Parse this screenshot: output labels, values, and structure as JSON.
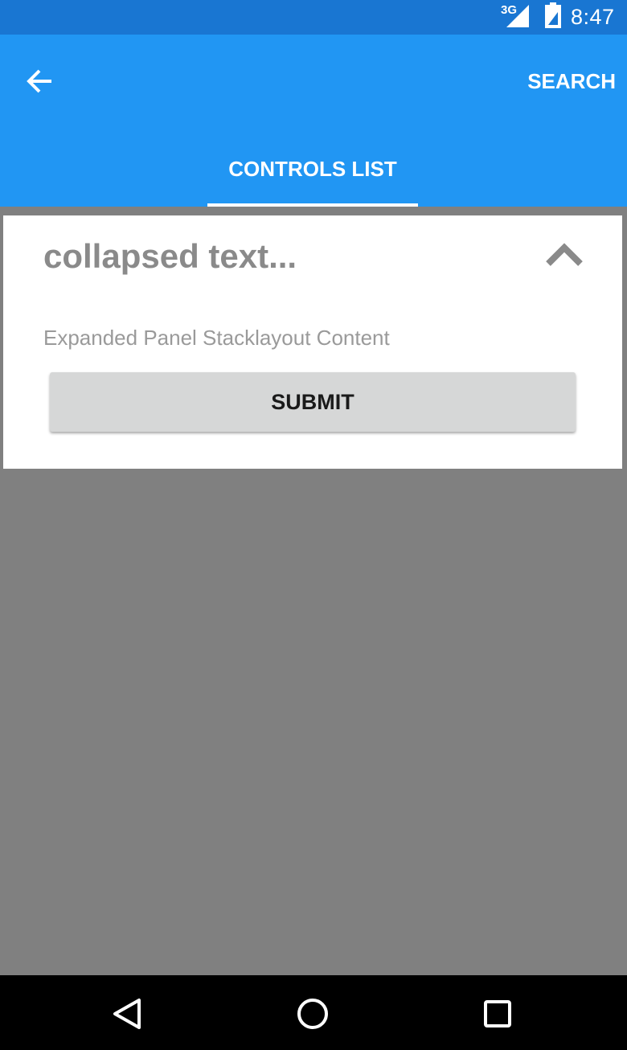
{
  "status_bar": {
    "network": "3G",
    "time": "8:47",
    "icons": [
      "signal-icon",
      "battery-icon"
    ]
  },
  "app_bar": {
    "back_icon": "arrow-back-icon",
    "search_label": "SEARCH",
    "tabs": [
      {
        "label": "CONTROLS LIST",
        "selected": true
      }
    ]
  },
  "expander": {
    "header": "collapsed text...",
    "toggle_icon": "chevron-up-icon",
    "content": "Expanded Panel Stacklayout Content",
    "submit_label": "SUBMIT"
  },
  "nav_bar": {
    "icons": [
      "nav-back-icon",
      "nav-home-icon",
      "nav-recents-icon"
    ]
  },
  "colors": {
    "status_bar": "#1976d2",
    "app_bar": "#2196f3",
    "background": "#808080",
    "card": "#ffffff",
    "button": "#d6d7d7",
    "nav_bar": "#000000"
  }
}
